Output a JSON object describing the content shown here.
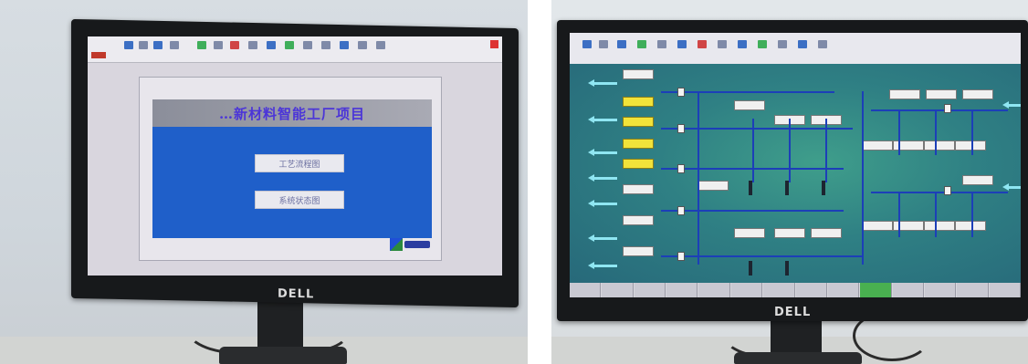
{
  "left_photo": {
    "monitor_brand": "DELL",
    "hmi": {
      "title": "…新材料智能工厂项目",
      "buttons": [
        "工艺流程图",
        "系统状态图"
      ]
    }
  },
  "right_photo": {
    "monitor_brand": "DELL",
    "hmi": {
      "screen": "process-flow-diagram",
      "bottom_tabs_count": 14
    }
  },
  "colors": {
    "hmi_blue": "#1f5fc9",
    "title_text": "#4b35d8",
    "process_bg": "#2f7f86",
    "pipe": "#1c3fb8",
    "active_tab": "#49b050",
    "highlight_tag": "#f2e33a"
  }
}
